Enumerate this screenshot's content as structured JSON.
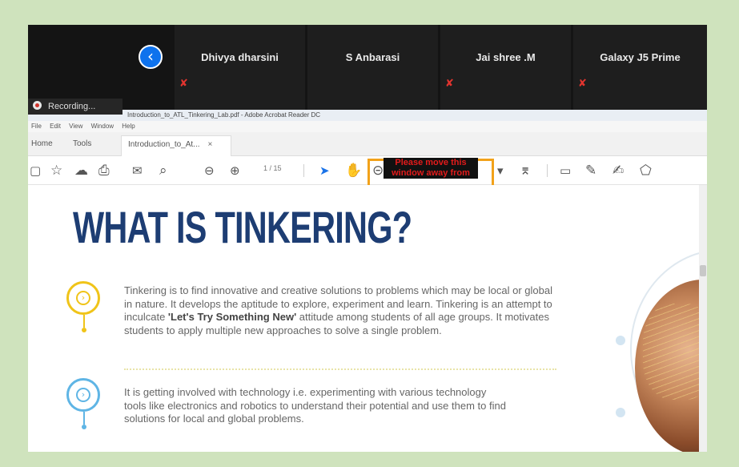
{
  "zoom": {
    "participants": [
      {
        "name": "Dhivya dharsini"
      },
      {
        "name": "S Anbarasi"
      },
      {
        "name": "Jai shree .M"
      },
      {
        "name": "Galaxy J5 Prime"
      }
    ],
    "back_icon": "chevron-left-icon",
    "mic_icon": "muted-mic-icon",
    "recording_label": "Recording..."
  },
  "acrobat": {
    "window_title": "Introduction_to_ATL_Tinkering_Lab.pdf - Adobe Acrobat Reader DC",
    "menu": [
      "File",
      "Edit",
      "View",
      "Window",
      "Help"
    ],
    "tabs": {
      "home": "Home",
      "tools": "Tools",
      "document": "Introduction_to_At...",
      "close": "×"
    },
    "page_indicator": "1 / 15",
    "overlay_warning": "Please move this window away from"
  },
  "doc": {
    "title": "WHAT IS TINKERING?",
    "para1_before": "Tinkering is to find innovative and creative solutions to problems which may be local or global in nature. It develops the aptitude to explore, experiment and learn. Tinkering is an attempt to inculcate ",
    "para1_bold": "'Let's Try Something New'",
    "para1_after": " attitude among students of all age groups. It motivates students to apply multiple new approaches to solve a single problem.",
    "para2": "It is getting involved with technology i.e. experimenting with various technology tools like electronics and robotics to understand their potential and use them to find solutions for local and global problems.",
    "bullet_glyph": "›"
  },
  "colors": {
    "title": "#1d3d73",
    "bullet1": "#f0c419",
    "bullet2": "#5fb5e5",
    "overlay_border": "#f2a21a",
    "overlay_text": "#e31b1b",
    "zoom_bg": "#141414",
    "page_bg": "#cfe3bd"
  }
}
